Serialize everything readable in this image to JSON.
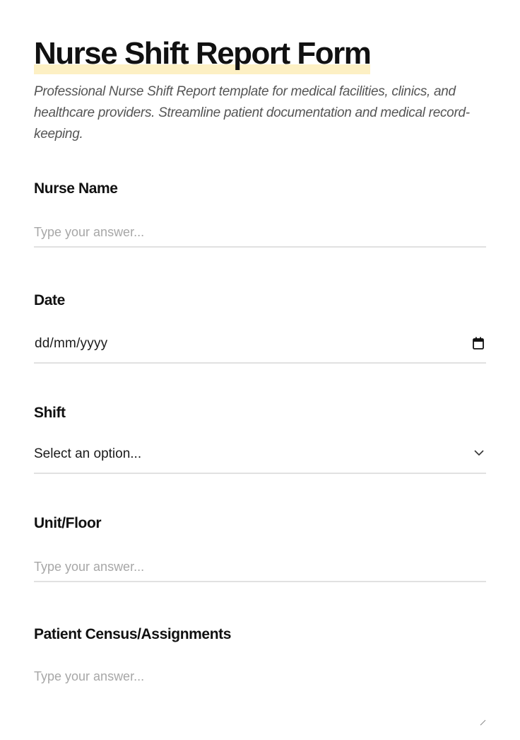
{
  "form": {
    "title": "Nurse Shift Report Form",
    "description": "Professional Nurse Shift Report template for medical facilities, clinics, and healthcare providers. Streamline patient documentation and medical record-keeping."
  },
  "questions": [
    {
      "label": "Nurse Name",
      "type": "text",
      "placeholder": "Type your answer..."
    },
    {
      "label": "Date",
      "type": "date",
      "value": "dd/mm/yyyy"
    },
    {
      "label": "Shift",
      "type": "select",
      "value": "Select an option..."
    },
    {
      "label": "Unit/Floor",
      "type": "text",
      "placeholder": "Type your answer..."
    },
    {
      "label": "Patient Census/Assignments",
      "type": "textarea",
      "placeholder": "Type your answer..."
    }
  ],
  "icons": {
    "date": "calendar-icon",
    "select": "chevron-down-icon",
    "textarea": "resize-handle-icon"
  },
  "colors": {
    "title_highlight": "#fdf0c4",
    "text": "#111111",
    "description": "#555555",
    "placeholder": "#a7a7a7",
    "underline": "#e1e1e1"
  }
}
